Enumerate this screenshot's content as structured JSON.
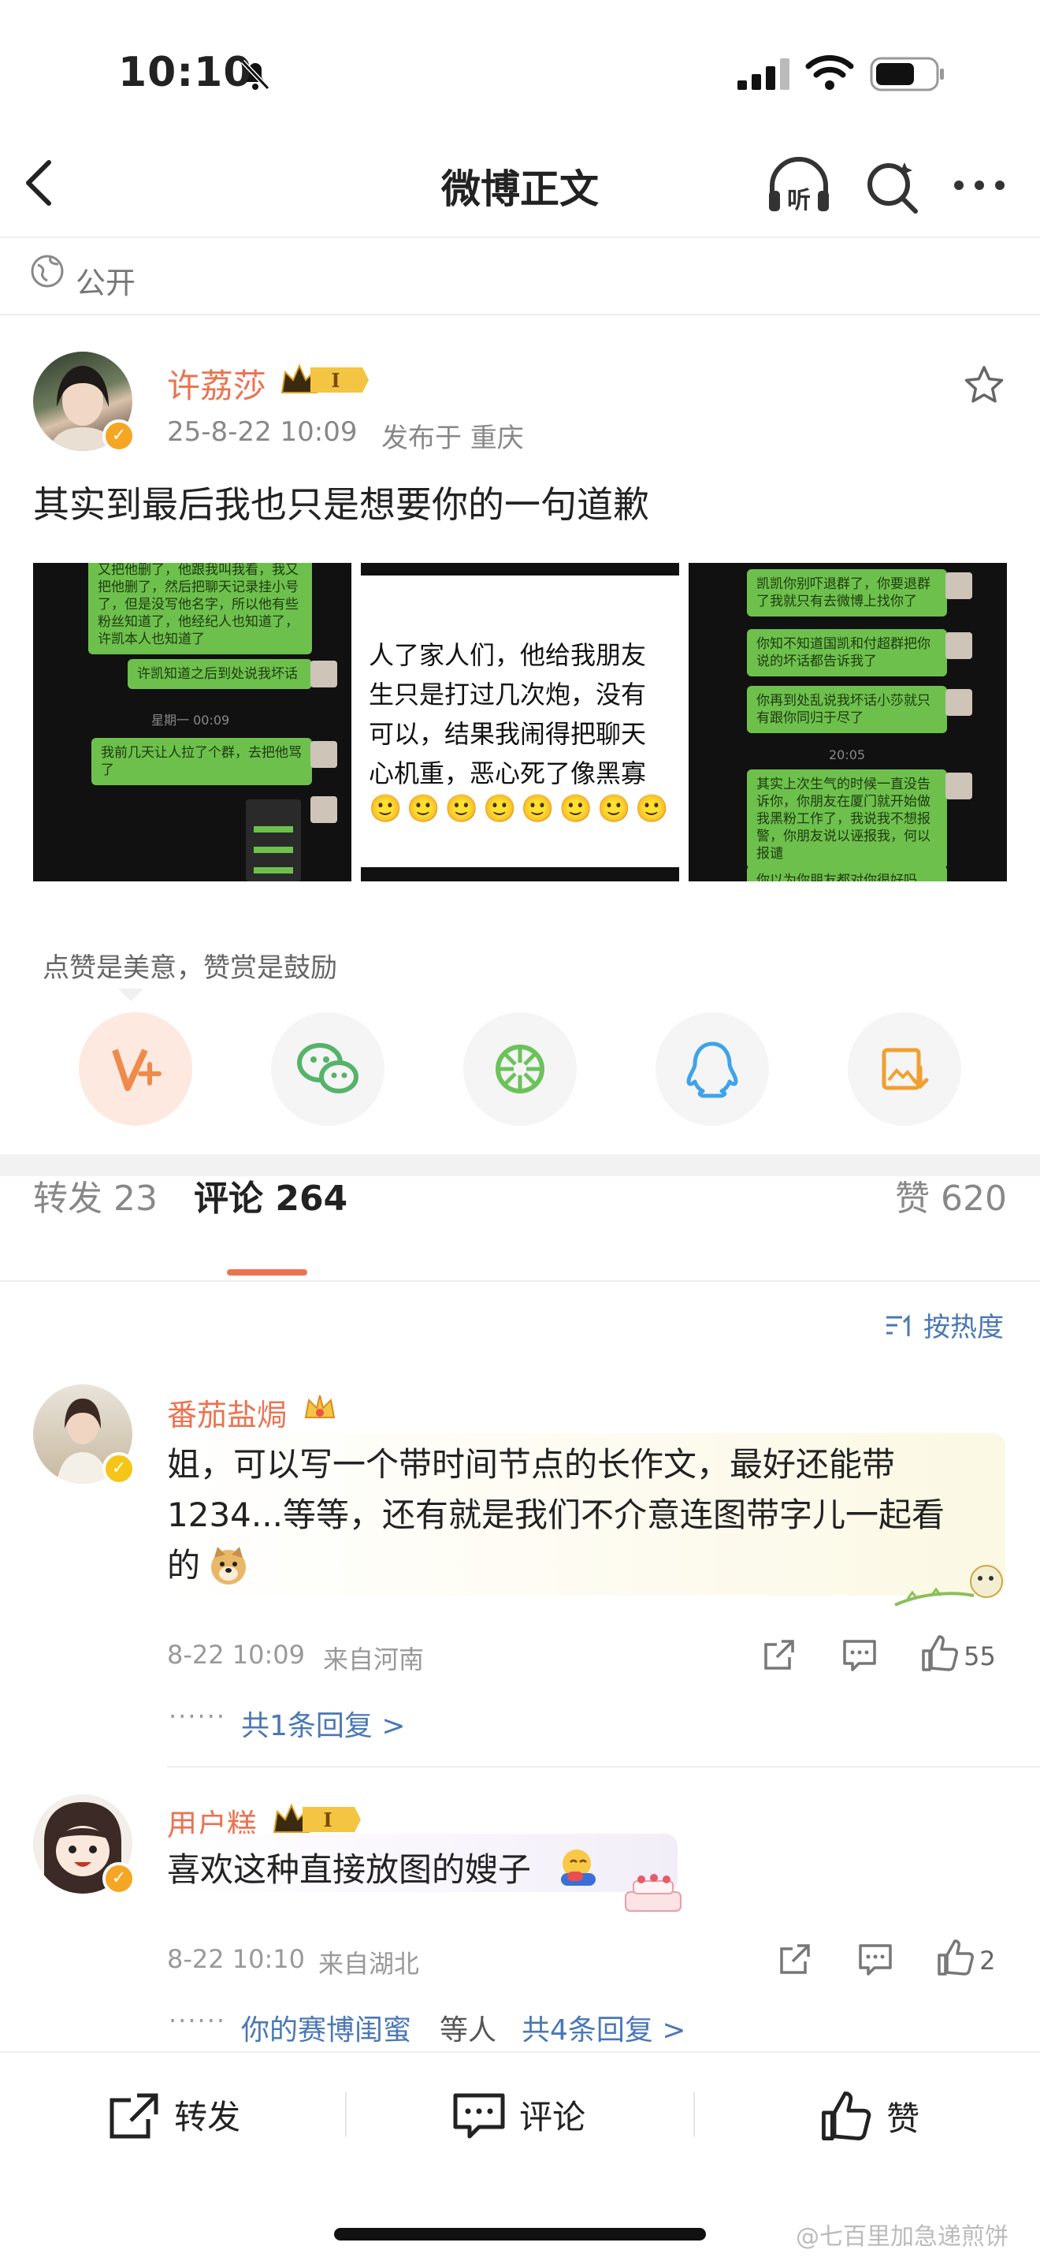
{
  "status_bar": {
    "time": "10:10"
  },
  "nav": {
    "title": "微博正文"
  },
  "visibility": {
    "label": "公开"
  },
  "post": {
    "author": "许荔莎",
    "badge_level": "I",
    "date": "25-8-22 10:09",
    "location": "发布于 重庆",
    "text": "其实到最后我也只是想要你的一句道歉",
    "images": [
      {
        "bubbles": [
          "又把他删了，他跟我叫我看，我又把他删了，然后把聊天记录挂小号了，但是没写他名字，所以他有些粉丝知道了，他经纪人也知道了，许凯本人也知道了",
          "许凯知道之后到处说我坏话",
          "我前几天让人拉了个群，去把他骂了"
        ],
        "time": "星期一 00:09"
      },
      {
        "lines": [
          "人了家人们，他给我朋友",
          "生只是打过几次炮，没有",
          "可以，结果我闹得把聊天",
          "心机重，恶心死了像黑寡"
        ]
      },
      {
        "bubbles": [
          "凯凯你别吓退群了，你要退群了我就只有去微博上找你了",
          "你知不知道国凯和付超群把你说的坏话都告诉我了",
          "你再到处乱说我坏话小莎就只有跟你同归于尽了",
          "其实上次生气的时候一直没告诉你，你朋友在厦门就开始做我黑粉工作了，我说我不想报警，你朋友说以诬报我，何以报谴",
          "你以为你朋友都对你很好吗，还到"
        ],
        "time": "20:05"
      }
    ]
  },
  "praise_tip": "点赞是美意，赞赏是鼓励",
  "share": [
    "v-plus-icon",
    "wechat-icon",
    "moments-icon",
    "qq-icon",
    "save-image-icon"
  ],
  "tabs": {
    "repost_label": "转发",
    "repost_count": "23",
    "comment_label": "评论",
    "comment_count": "264",
    "like_label": "赞",
    "like_count": "620"
  },
  "sort_label": "按热度",
  "comments": [
    {
      "name": "番茄盐焗",
      "text_line1": "姐，可以写一个带时间节点的长作文，最好还能带",
      "text_line2": "1234...等等，还有就是我们不介意连图带字儿一起看",
      "text_line3": "的",
      "time": "8-22 10:09",
      "from": "来自河南",
      "likes": "55",
      "replies": "共1条回复 >"
    },
    {
      "name": "用户糕",
      "badge_level": "I",
      "text": "喜欢这种直接放图的嫂子",
      "time": "8-22 10:10",
      "from": "来自湖北",
      "likes": "2",
      "reply_user": "你的赛博闺蜜",
      "reply_suffix": "等人",
      "replies": "共4条回复 >"
    }
  ],
  "bottom": {
    "repost": "转发",
    "comment": "评论",
    "like": "赞"
  },
  "watermark": "@七百里加急递煎饼",
  "colors": {
    "accent": "#eb7350",
    "link": "#4a78b5",
    "bubble": "#6ec04d"
  }
}
